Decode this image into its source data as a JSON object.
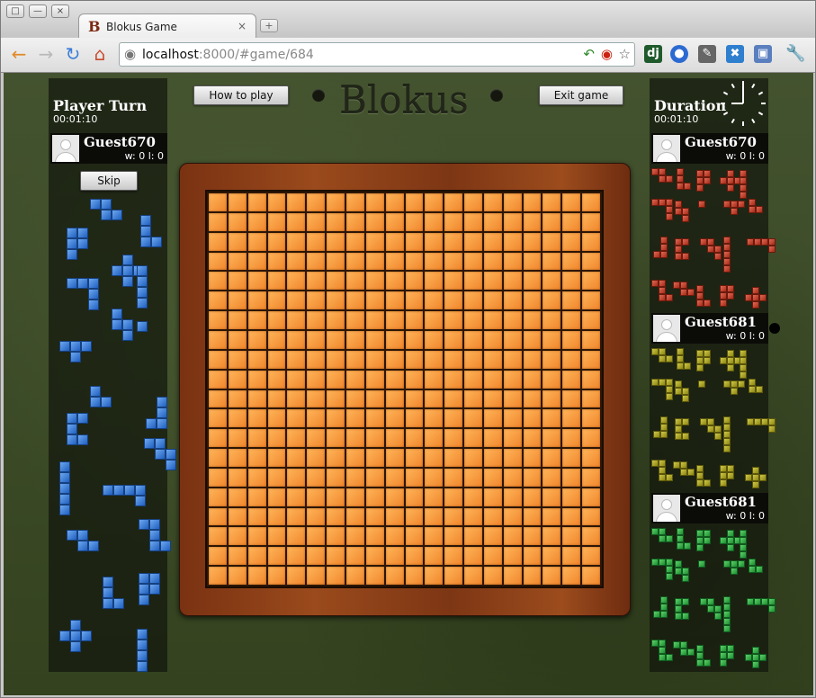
{
  "browser": {
    "tab_title": "Blokus Game",
    "tab_favicon": "B",
    "tab_close": "×",
    "new_tab": "+",
    "url_host": "localhost",
    "url_rest": ":8000/#game/684",
    "window_buttons": [
      "□",
      "—",
      "×"
    ]
  },
  "game": {
    "logo": "Blokus",
    "how_to_play": "How to play",
    "exit_game": "Exit game",
    "skip": "Skip"
  },
  "left_panel": {
    "title": "Player Turn",
    "time": "00:01:10",
    "player": {
      "name": "Guest670",
      "score": "w: 0 l: 0"
    }
  },
  "right_panel": {
    "title": "Duration",
    "time": "00:01:10",
    "players": [
      {
        "name": "Guest670",
        "score": "w: 0 l: 0",
        "color": "#b8301c"
      },
      {
        "name": "Guest681",
        "score": "w: 0 l: 0",
        "color": "#a8a11e"
      },
      {
        "name": "Guest681",
        "score": "w: 0 l: 0",
        "color": "#2ea844"
      }
    ]
  },
  "colors": {
    "blue": "#2f6fd0",
    "red": "#b8301c",
    "yellow": "#a8a11e",
    "green": "#2ea844"
  },
  "board": {
    "size": 20
  }
}
